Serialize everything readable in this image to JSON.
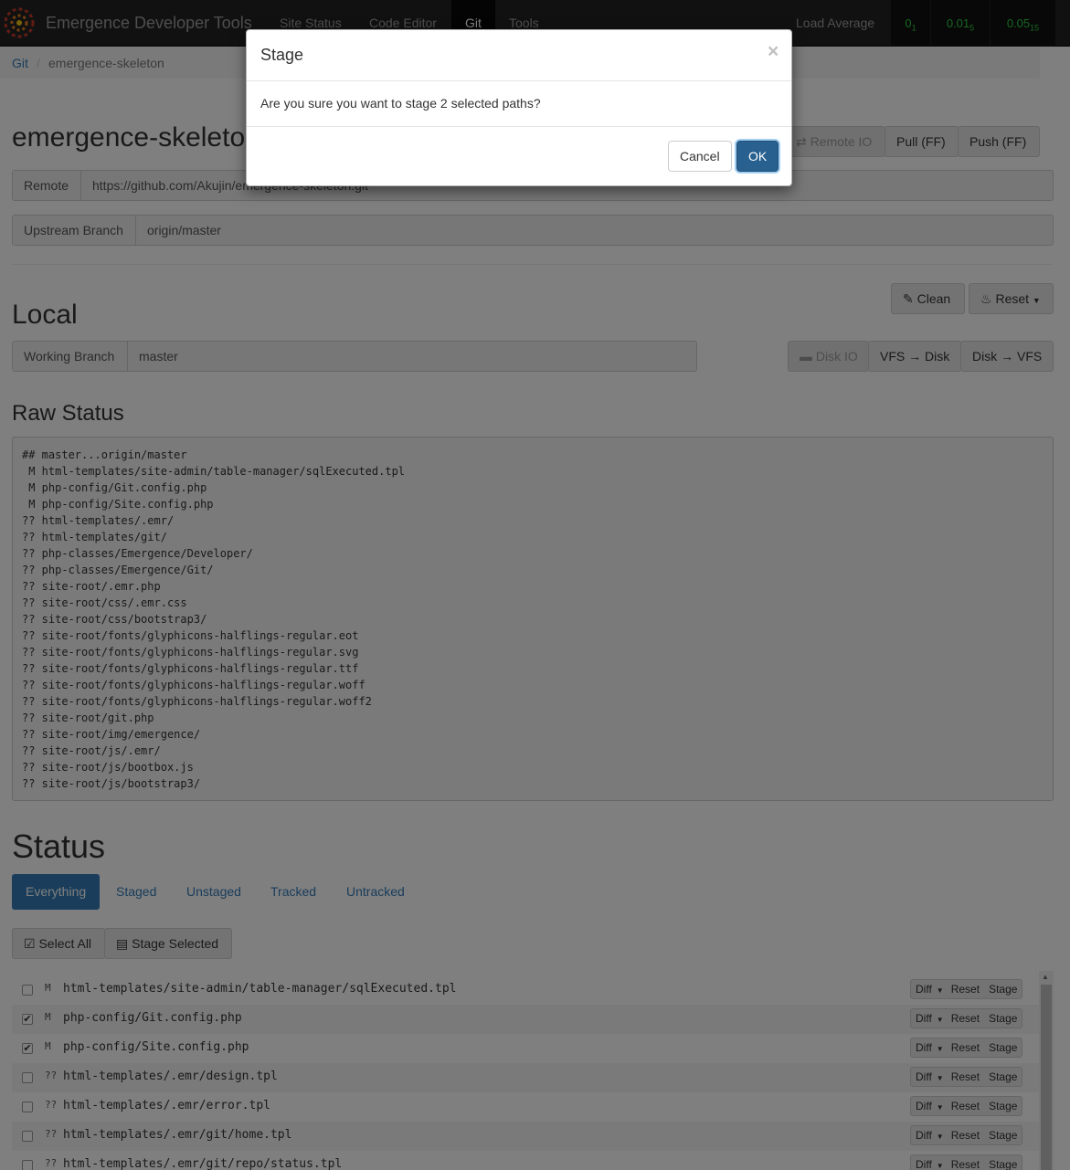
{
  "navbar": {
    "brand": "Emergence Developer Tools",
    "items": [
      {
        "label": "Site Status"
      },
      {
        "label": "Code Editor"
      },
      {
        "label": "Git"
      },
      {
        "label": "Tools"
      }
    ],
    "active": "Git",
    "load_label": "Load Average",
    "load": [
      {
        "value": "0",
        "sub": "1"
      },
      {
        "value": "0.01",
        "sub": "5"
      },
      {
        "value": "0.05",
        "sub": "15"
      }
    ]
  },
  "breadcrumb": {
    "root": "Git",
    "separator": "/",
    "current": "emergence-skeleton"
  },
  "repo": {
    "title": "emergence-skeleton",
    "remote_io_label": "Remote IO",
    "pull_label": "Pull (FF)",
    "push_label": "Push (FF)",
    "remote_label": "Remote",
    "remote_value": "https://github.com/Akujin/emergence-skeleton.git",
    "upstream_label": "Upstream Branch",
    "upstream_value": "origin/master"
  },
  "local": {
    "title": "Local",
    "clean_label": "Clean",
    "reset_label": "Reset",
    "working_branch_label": "Working Branch",
    "working_branch_value": "master",
    "disk_io_label": "Disk IO",
    "vfs_to_disk_label": "VFS → Disk",
    "disk_to_vfs_label": "Disk → VFS"
  },
  "raw_status": {
    "title": "Raw Status",
    "lines": [
      "## master...origin/master",
      " M html-templates/site-admin/table-manager/sqlExecuted.tpl",
      " M php-config/Git.config.php",
      " M php-config/Site.config.php",
      "?? html-templates/.emr/",
      "?? html-templates/git/",
      "?? php-classes/Emergence/Developer/",
      "?? php-classes/Emergence/Git/",
      "?? site-root/.emr.php",
      "?? site-root/css/.emr.css",
      "?? site-root/css/bootstrap3/",
      "?? site-root/fonts/glyphicons-halflings-regular.eot",
      "?? site-root/fonts/glyphicons-halflings-regular.svg",
      "?? site-root/fonts/glyphicons-halflings-regular.ttf",
      "?? site-root/fonts/glyphicons-halflings-regular.woff",
      "?? site-root/fonts/glyphicons-halflings-regular.woff2",
      "?? site-root/git.php",
      "?? site-root/img/emergence/",
      "?? site-root/js/.emr/",
      "?? site-root/js/bootbox.js",
      "?? site-root/js/bootstrap3/"
    ]
  },
  "status": {
    "title": "Status",
    "tabs": [
      {
        "label": "Everything"
      },
      {
        "label": "Staged"
      },
      {
        "label": "Unstaged"
      },
      {
        "label": "Tracked"
      },
      {
        "label": "Untracked"
      }
    ],
    "active_tab": "Everything",
    "select_all_label": "Select All",
    "stage_selected_label": "Stage Selected",
    "row_actions": {
      "diff": "Diff",
      "reset": "Reset",
      "stage": "Stage"
    },
    "files": [
      {
        "code": "M",
        "path": "html-templates/site-admin/table-manager/sqlExecuted.tpl",
        "checked": false
      },
      {
        "code": "M",
        "path": "php-config/Git.config.php",
        "checked": true
      },
      {
        "code": "M",
        "path": "php-config/Site.config.php",
        "checked": true
      },
      {
        "code": "??",
        "path": "html-templates/.emr/design.tpl",
        "checked": false
      },
      {
        "code": "??",
        "path": "html-templates/.emr/error.tpl",
        "checked": false
      },
      {
        "code": "??",
        "path": "html-templates/.emr/git/home.tpl",
        "checked": false
      },
      {
        "code": "??",
        "path": "html-templates/.emr/git/repo/status.tpl",
        "checked": false
      }
    ]
  },
  "modal": {
    "title": "Stage",
    "close": "×",
    "message": "Are you sure you want to stage 2 selected paths?",
    "cancel_label": "Cancel",
    "ok_label": "OK"
  },
  "colors": {
    "primary": "#337ab7",
    "navbar": "#222222",
    "load_green": "#2ecc40"
  }
}
